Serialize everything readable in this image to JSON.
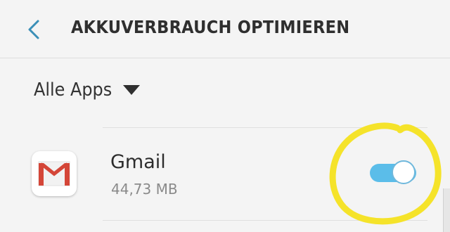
{
  "header": {
    "title": "AKKUVERBRAUCH OPTIMIEREN",
    "back_icon": "chevron-left-icon"
  },
  "filter": {
    "label": "Alle Apps",
    "icon": "dropdown-triangle-icon"
  },
  "apps": [
    {
      "name": "Gmail",
      "size": "44,73 MB",
      "icon": "gmail-icon",
      "optimized_toggle_on": true
    }
  ],
  "colors": {
    "accent": "#5bbde9",
    "back_icon": "#3a8fb7",
    "annotation": "#f5e32a",
    "gmail_red": "#d44638"
  }
}
